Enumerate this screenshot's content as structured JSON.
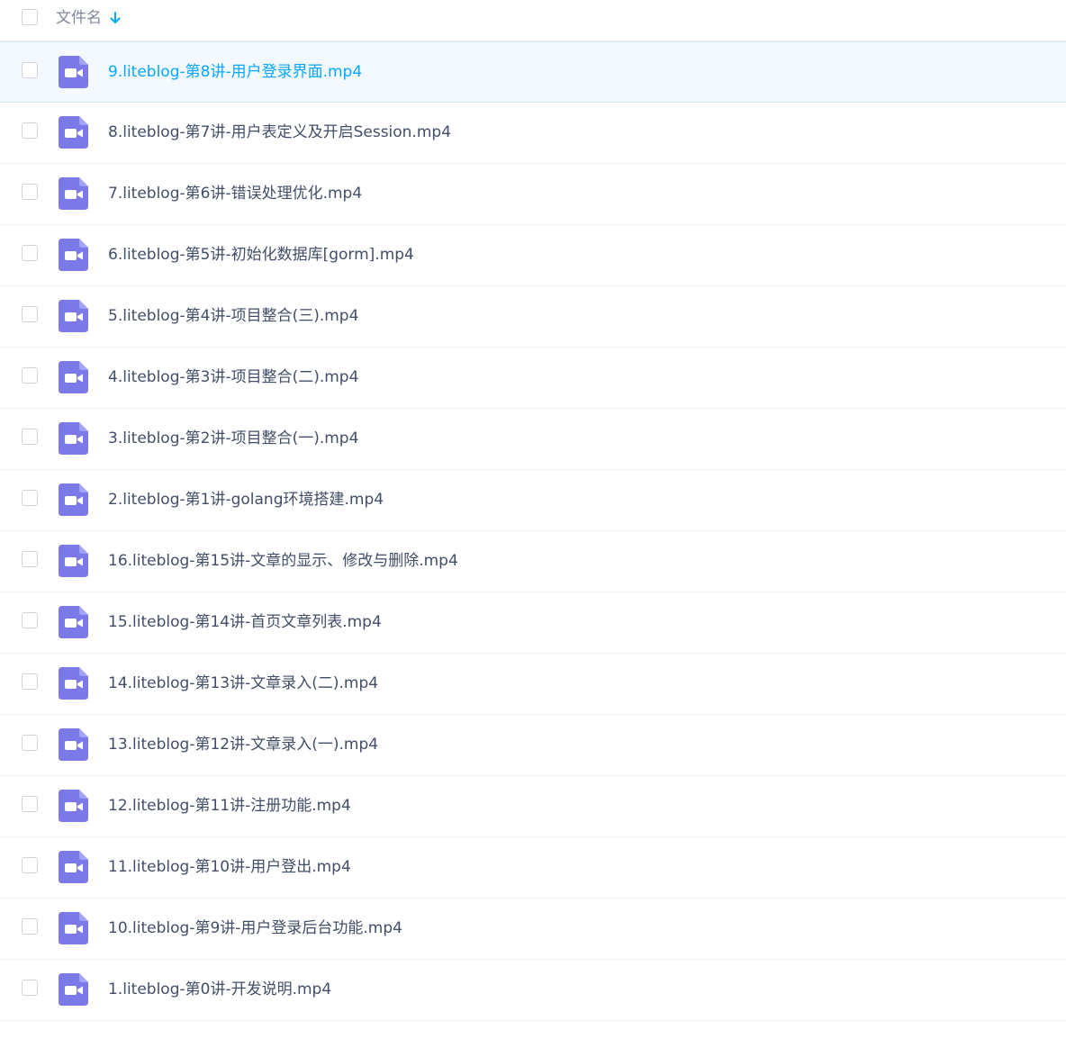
{
  "header": {
    "column_label": "文件名",
    "sort_icon": "arrow-down-icon"
  },
  "colors": {
    "accent": "#06a7ff",
    "video_icon": "#7b79e8",
    "selected_row_bg": "#f4f9ff"
  },
  "files": [
    {
      "name": "9.liteblog-第8讲-用户登录界面.mp4",
      "icon": "video-file-icon",
      "active": true
    },
    {
      "name": "8.liteblog-第7讲-用户表定义及开启Session.mp4",
      "icon": "video-file-icon",
      "active": false
    },
    {
      "name": "7.liteblog-第6讲-错误处理优化.mp4",
      "icon": "video-file-icon",
      "active": false
    },
    {
      "name": "6.liteblog-第5讲-初始化数据库[gorm].mp4",
      "icon": "video-file-icon",
      "active": false
    },
    {
      "name": "5.liteblog-第4讲-项目整合(三).mp4",
      "icon": "video-file-icon",
      "active": false
    },
    {
      "name": "4.liteblog-第3讲-项目整合(二).mp4",
      "icon": "video-file-icon",
      "active": false
    },
    {
      "name": "3.liteblog-第2讲-项目整合(一).mp4",
      "icon": "video-file-icon",
      "active": false
    },
    {
      "name": "2.liteblog-第1讲-golang环境搭建.mp4",
      "icon": "video-file-icon",
      "active": false
    },
    {
      "name": "16.liteblog-第15讲-文章的显示、修改与删除.mp4",
      "icon": "video-file-icon",
      "active": false
    },
    {
      "name": "15.liteblog-第14讲-首页文章列表.mp4",
      "icon": "video-file-icon",
      "active": false
    },
    {
      "name": "14.liteblog-第13讲-文章录入(二).mp4",
      "icon": "video-file-icon",
      "active": false
    },
    {
      "name": "13.liteblog-第12讲-文章录入(一).mp4",
      "icon": "video-file-icon",
      "active": false
    },
    {
      "name": "12.liteblog-第11讲-注册功能.mp4",
      "icon": "video-file-icon",
      "active": false
    },
    {
      "name": "11.liteblog-第10讲-用户登出.mp4",
      "icon": "video-file-icon",
      "active": false
    },
    {
      "name": "10.liteblog-第9讲-用户登录后台功能.mp4",
      "icon": "video-file-icon",
      "active": false
    },
    {
      "name": "1.liteblog-第0讲-开发说明.mp4",
      "icon": "video-file-icon",
      "active": false
    }
  ]
}
